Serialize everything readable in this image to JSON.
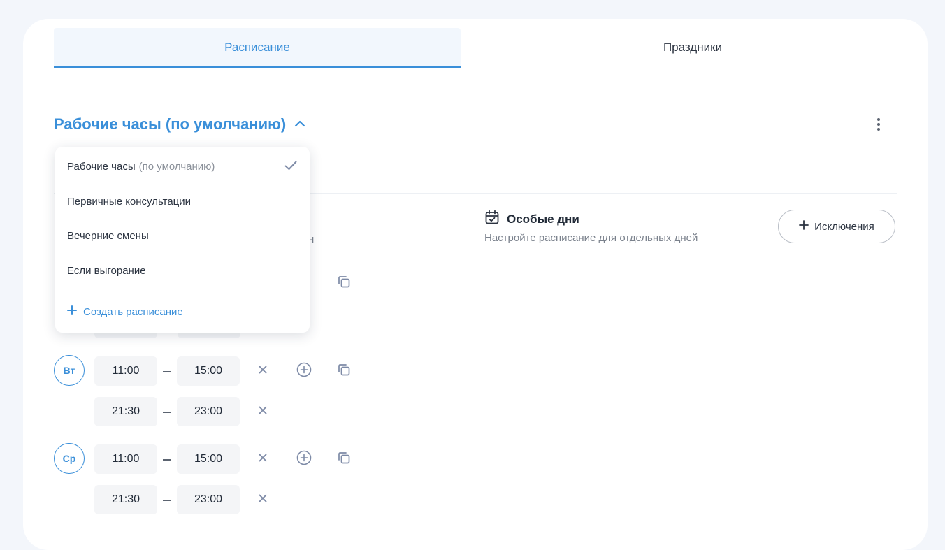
{
  "tabs": [
    {
      "label": "Расписание",
      "active": true
    },
    {
      "label": "Праздники",
      "active": false
    }
  ],
  "schedule": {
    "title": "Рабочие часы (по умолчанию)"
  },
  "dropdown": {
    "items": [
      {
        "label": "Рабочие часы",
        "muted": "(по умолчанию)",
        "selected": true
      },
      {
        "label": "Первичные консультации",
        "muted": "",
        "selected": false
      },
      {
        "label": "Вечерние смены",
        "muted": "",
        "selected": false
      },
      {
        "label": "Если выгорание",
        "muted": "",
        "selected": false
      }
    ],
    "create_label": "Создать расписание"
  },
  "hidden_hint_tail": "н",
  "special_days": {
    "title": "Особые дни",
    "subtitle": "Настройте расписание для отдельных дней",
    "exceptions_label": "Исключения"
  },
  "days": [
    {
      "label": "Вт",
      "slots": [
        {
          "from": "11:00",
          "to": "15:00"
        },
        {
          "from": "21:30",
          "to": "23:00"
        }
      ]
    },
    {
      "label": "Ср",
      "slots": [
        {
          "from": "11:00",
          "to": "15:00"
        },
        {
          "from": "21:30",
          "to": "23:00"
        }
      ]
    }
  ],
  "colors": {
    "accent": "#3a8fd9",
    "text": "#222b38",
    "muted": "#7a818c",
    "icon": "#7d8aa6"
  }
}
